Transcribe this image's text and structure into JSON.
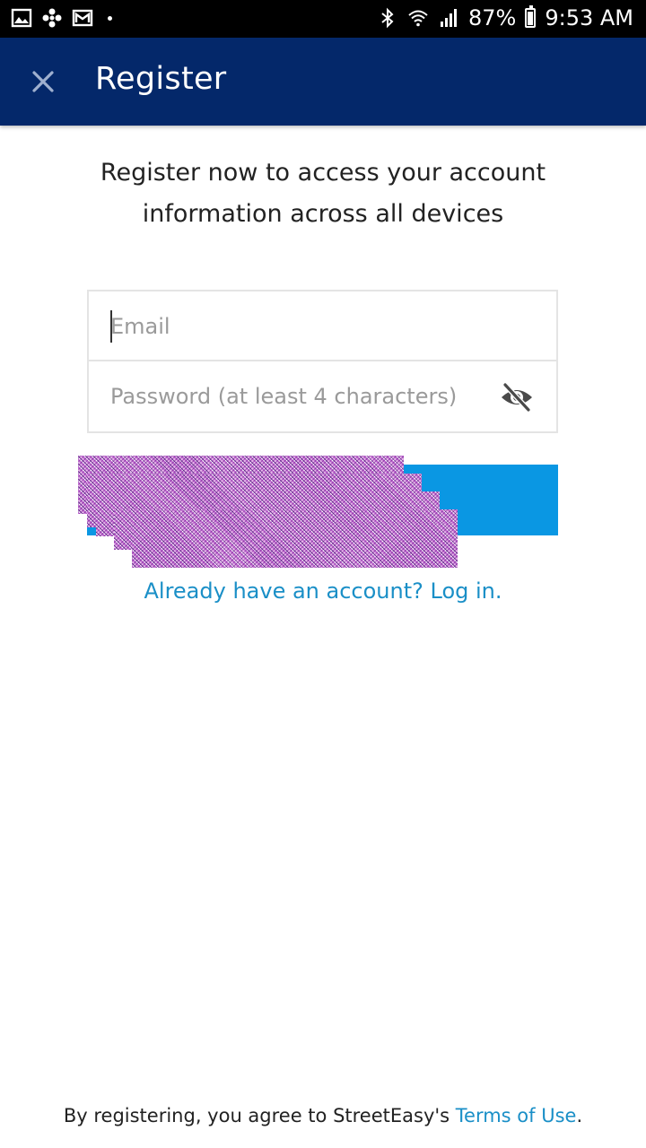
{
  "status_bar": {
    "battery_percent": "87%",
    "time": "9:53 AM",
    "left_icons": [
      "gallery-icon",
      "fan-icon",
      "gmail-icon",
      "dot-icon"
    ],
    "right_icons": [
      "bluetooth-icon",
      "wifi-icon",
      "signal-icon",
      "battery-icon"
    ]
  },
  "app_bar": {
    "title": "Register",
    "close_icon": "close-icon",
    "background": "#04286a"
  },
  "intro": {
    "line1": "Register now to access your account",
    "line2": "information across all devices"
  },
  "form": {
    "email_placeholder": "Email",
    "email_value": "",
    "password_placeholder": "Password (at least 4 characters)",
    "password_value": "",
    "password_toggle_icon": "eye-off-icon"
  },
  "register_button": {
    "label": "",
    "color": "#0a97e3"
  },
  "login_link": "Already have an account? Log in.",
  "footer": {
    "prefix": "By registering, you agree to StreetEasy's ",
    "terms_label": "Terms of Use",
    "suffix": "."
  },
  "colors": {
    "link": "#1a8fc7",
    "text": "#222222"
  }
}
